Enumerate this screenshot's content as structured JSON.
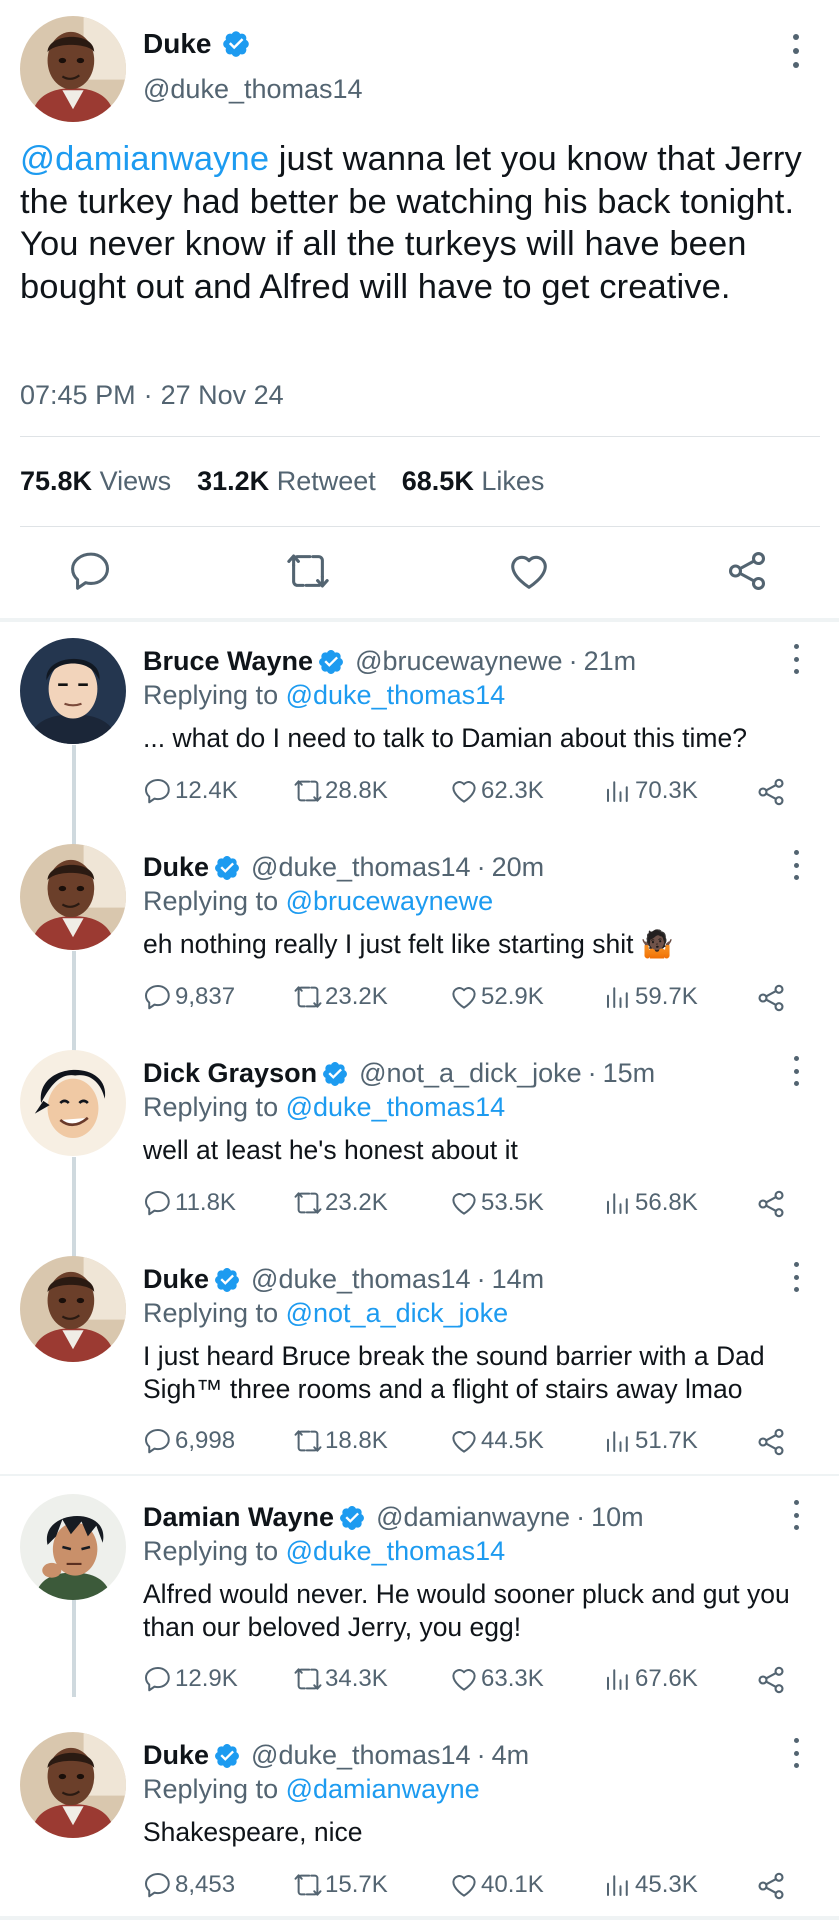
{
  "main_tweet": {
    "author_name": "Duke",
    "author_handle": "@duke_thomas14",
    "mention": "@damianwayne",
    "text": " just wanna let you know that Jerry the turkey had better be watching his back tonight. You never know if all the turkeys will have been bought out and Alfred will have to get creative.",
    "time": "07:45 PM",
    "date": "27 Nov 24",
    "views": "75.8K",
    "views_label": "Views",
    "retweets": "31.2K",
    "retweets_label": "Retweet",
    "likes": "68.5K",
    "likes_label": "Likes"
  },
  "icons": {
    "reply": "reply-icon",
    "retweet": "retweet-icon",
    "like": "heart-icon",
    "views": "views-icon",
    "share": "share-icon",
    "verified": "verified-badge-icon",
    "more": "more-options-icon"
  },
  "colors": {
    "accent": "#1d9bf0",
    "muted": "#536471",
    "text": "#0f1419"
  },
  "replies": [
    {
      "name": "Bruce Wayne",
      "handle": "@brucewaynewe",
      "time": "21m",
      "replying_label": "Replying to",
      "replying_to": "@duke_thomas14",
      "text": "... what do I need to talk to Damian about this time?",
      "emoji": "",
      "replies": "12.4K",
      "retweets": "28.8K",
      "likes": "62.3K",
      "views": "70.3K",
      "avatar": "bruce"
    },
    {
      "name": "Duke",
      "handle": "@duke_thomas14",
      "time": "20m",
      "replying_label": "Replying to",
      "replying_to": "@brucewaynewe",
      "text": "eh nothing really I just felt like starting shit",
      "emoji": "🤷🏿",
      "replies": "9,837",
      "retweets": "23.2K",
      "likes": "52.9K",
      "views": "59.7K",
      "avatar": "duke"
    },
    {
      "name": "Dick Grayson",
      "handle": "@not_a_dick_joke",
      "time": "15m",
      "replying_label": "Replying to",
      "replying_to": "@duke_thomas14",
      "text": "well at least he's honest about it",
      "emoji": "",
      "replies": "11.8K",
      "retweets": "23.2K",
      "likes": "53.5K",
      "views": "56.8K",
      "avatar": "dick"
    },
    {
      "name": "Duke",
      "handle": "@duke_thomas14",
      "time": "14m",
      "replying_label": "Replying to",
      "replying_to": "@not_a_dick_joke",
      "text": "I just heard Bruce break the sound barrier with a Dad Sigh™ three rooms and a flight of stairs away lmao",
      "emoji": "",
      "replies": "6,998",
      "retweets": "18.8K",
      "likes": "44.5K",
      "views": "51.7K",
      "avatar": "duke"
    },
    {
      "name": "Damian Wayne",
      "handle": "@damianwayne",
      "time": "10m",
      "replying_label": "Replying to",
      "replying_to": "@duke_thomas14",
      "text": "Alfred would never. He would sooner pluck and gut you than our beloved Jerry, you egg!",
      "emoji": "",
      "replies": "12.9K",
      "retweets": "34.3K",
      "likes": "63.3K",
      "views": "67.6K",
      "avatar": "damian"
    },
    {
      "name": "Duke",
      "handle": "@duke_thomas14",
      "time": "4m",
      "replying_label": "Replying to",
      "replying_to": "@damianwayne",
      "text": "Shakespeare, nice",
      "emoji": "",
      "replies": "8,453",
      "retweets": "15.7K",
      "likes": "40.1K",
      "views": "45.3K",
      "avatar": "duke"
    }
  ]
}
